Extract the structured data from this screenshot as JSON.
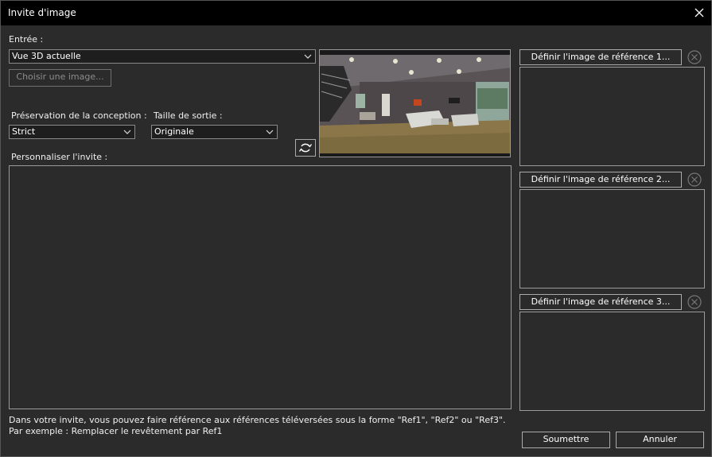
{
  "window": {
    "title": "Invite d'image"
  },
  "input": {
    "label": "Entrée :",
    "source_value": "Vue 3D actuelle",
    "choose_image_label": "Choisir une image..."
  },
  "preservation": {
    "label": "Préservation de la conception :",
    "value": "Strict"
  },
  "output_size": {
    "label": "Taille de sortie :",
    "value": "Originale"
  },
  "prompt": {
    "label": "Personnaliser l'invite :",
    "value": ""
  },
  "references": [
    {
      "label": "Définir l'image de référence 1..."
    },
    {
      "label": "Définir l'image de référence 2..."
    },
    {
      "label": "Définir l'image de référence 3..."
    }
  ],
  "hints": {
    "line1": "Dans votre invite, vous pouvez faire référence aux références téléversées sous la forme \"Ref1\", \"Ref2\" ou \"Ref3\".",
    "line2": "Par exemple : Remplacer le revêtement par Ref1"
  },
  "actions": {
    "submit_label": "Soumettre",
    "cancel_label": "Annuler"
  },
  "icons": {
    "close": "close-icon",
    "chevron": "chevron-down-icon",
    "refresh": "refresh-icon",
    "clear": "clear-circle-icon"
  }
}
